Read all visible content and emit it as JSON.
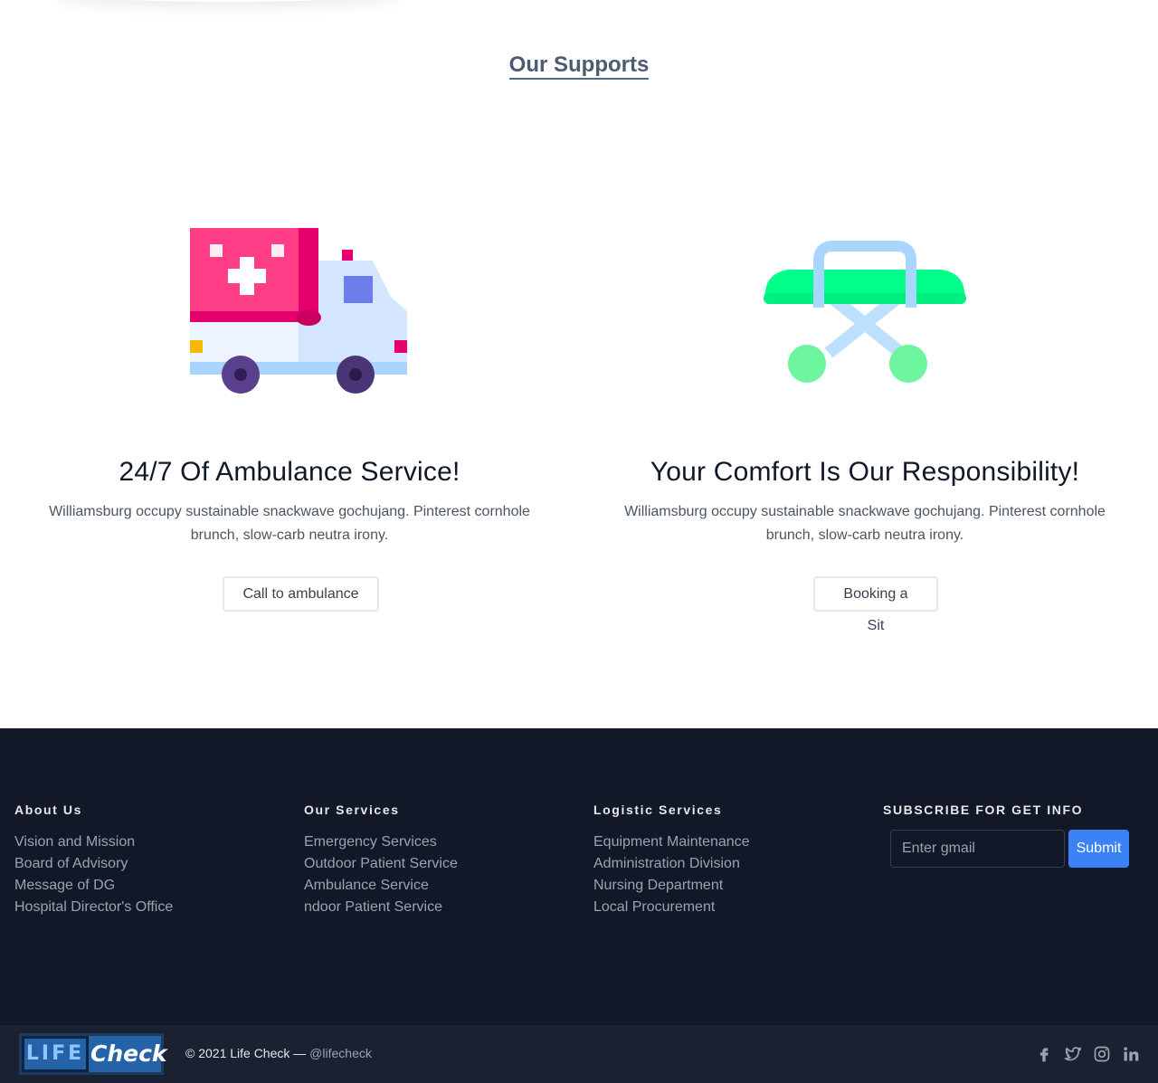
{
  "supports": {
    "title": "Our Supports",
    "cards": [
      {
        "heading": "24/7 Of Ambulance Service!",
        "text": "Williamsburg occupy sustainable snackwave gochujang. Pinterest cornhole brunch, slow-carb neutra irony.",
        "button": "Call to ambulance",
        "icon": "ambulance-icon"
      },
      {
        "heading": "Your Comfort Is Our Responsibility!",
        "text": "Williamsburg occupy sustainable snackwave gochujang. Pinterest cornhole brunch, slow-carb neutra irony.",
        "button": "Booking a Sit",
        "icon": "stretcher-icon"
      }
    ]
  },
  "footer": {
    "columns": [
      {
        "title": "About Us",
        "items": [
          "Vision and Mission",
          "Board of Advisory",
          "Message of DG",
          "Hospital Director's Office"
        ]
      },
      {
        "title": "Our Services",
        "items": [
          "Emergency Services",
          "Outdoor Patient Service",
          "Ambulance Service",
          "ndoor Patient Service"
        ]
      },
      {
        "title": "Logistic Services",
        "items": [
          "Equipment Maintenance",
          "Administration Division",
          "Nursing Department",
          "Local Procurement"
        ]
      }
    ],
    "subscribe": {
      "title": "SUBSCRIBE FOR GET INFO",
      "placeholder": "Enter gmail",
      "button": "Submit"
    },
    "logo": {
      "part1": "LIFE",
      "part2": "Check"
    },
    "copyright": "© 2021 Life Check —",
    "handle": "@lifecheck",
    "socials": [
      "facebook-icon",
      "twitter-icon",
      "instagram-icon",
      "linkedin-icon"
    ],
    "colors": {
      "background": "#121827",
      "bottom_bar": "#1a2232",
      "accent": "#3b82f6"
    }
  }
}
